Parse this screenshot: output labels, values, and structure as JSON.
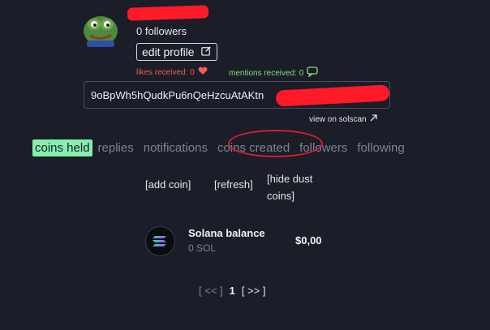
{
  "profile": {
    "followers_text": "0 followers",
    "edit_label": "edit profile",
    "likes_text": "likes received: 0",
    "mentions_text": "mentions received: 0",
    "address": "9oBpWh5hQudkPu6nQeHzcuAtAKtn",
    "solscan_label": "view on solscan"
  },
  "tabs": [
    "coins held",
    "replies",
    "notifications",
    "coins created",
    "followers",
    "following"
  ],
  "actions": {
    "add": "[add coin]",
    "refresh": "[refresh]",
    "hide": "[hide dust coins]"
  },
  "holding": {
    "name": "Solana balance",
    "amount": "0 SOL",
    "value": "$0,00"
  },
  "pager": {
    "prev": "[ << ]",
    "current": "1",
    "next": "[ >> ]"
  },
  "colors": {
    "background": "#1b1d28",
    "active_tab": "#86efac",
    "likes": "#ef5b5b",
    "mentions": "#7fe07f",
    "annotation": "#d3202e"
  }
}
